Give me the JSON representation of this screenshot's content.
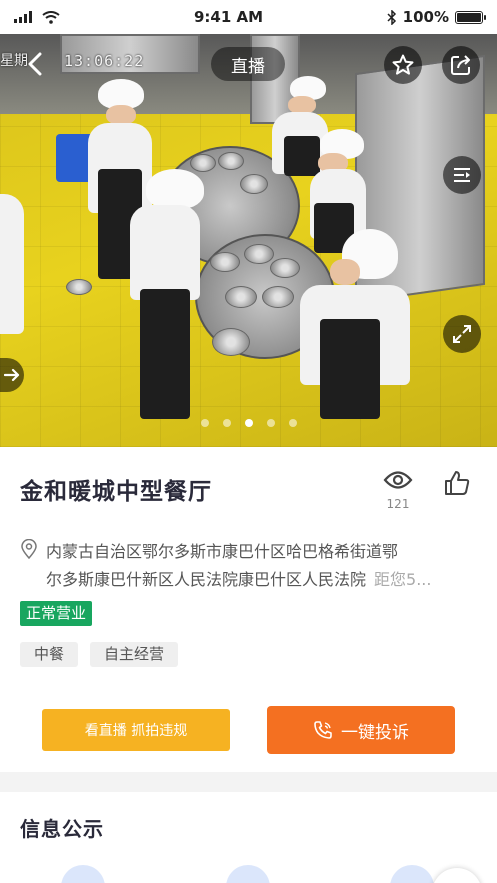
{
  "status_bar": {
    "time": "9:41 AM",
    "battery": "100%"
  },
  "video": {
    "timestamp": "13:06:22",
    "left_overlay_text": "星期",
    "live_label": "直播",
    "page_count": 5,
    "active_page": 3
  },
  "restaurant": {
    "name": "金和暖城中型餐厅",
    "view_count": "121",
    "address_line1": "内蒙古自治区鄂尔多斯市康巴什区哈巴格希街道鄂",
    "address_line2": "尔多斯康巴什新区人民法院康巴什区人民法院",
    "distance": "距您5...",
    "status": "正常营业",
    "tags": [
      "中餐",
      "自主经营"
    ]
  },
  "actions": {
    "watch_label": "看直播 抓拍违规",
    "complain_label": "一键投诉"
  },
  "info_section": {
    "title": "信息公示"
  },
  "colors": {
    "status_green": "#18a65f",
    "watch_yellow": "#f6b222",
    "complain_orange": "#f47021"
  }
}
